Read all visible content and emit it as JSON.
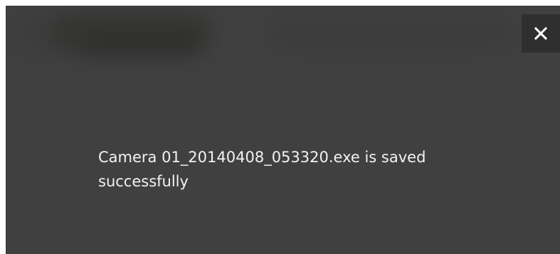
{
  "dialog": {
    "message": "Camera 01_20140408_053320.exe is saved successfully",
    "close_icon": "close-icon"
  },
  "colors": {
    "overlay": "#404040",
    "close_button_bg": "#2f2f2f",
    "text": "#f2f2f2"
  }
}
